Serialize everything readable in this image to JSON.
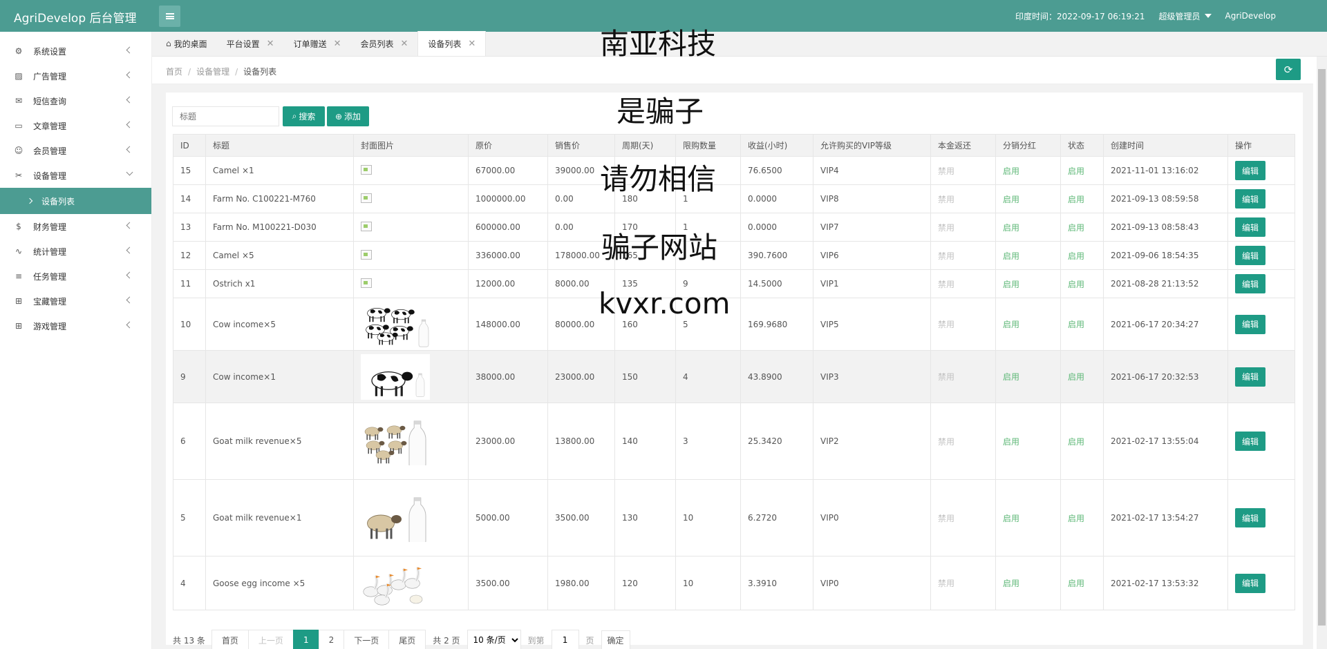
{
  "header": {
    "logo": "AgriDevelop 后台管理",
    "time_label": "印度时间：2022-09-17 06:19:21",
    "user_role": "超级管理员",
    "site_name": "AgriDevelop"
  },
  "sidebar": {
    "items": [
      {
        "label": "系统设置",
        "icon": "gear-icon"
      },
      {
        "label": "广告管理",
        "icon": "image-icon"
      },
      {
        "label": "短信查询",
        "icon": "mail-icon"
      },
      {
        "label": "文章管理",
        "icon": "book-icon"
      },
      {
        "label": "会员管理",
        "icon": "users-icon"
      },
      {
        "label": "设备管理",
        "icon": "tools-icon"
      },
      {
        "label": "设备列表",
        "icon": "chevron-right-icon"
      },
      {
        "label": "财务管理",
        "icon": "dollar-icon"
      },
      {
        "label": "统计管理",
        "icon": "pulse-icon"
      },
      {
        "label": "任务管理",
        "icon": "sliders-icon"
      },
      {
        "label": "宝藏管理",
        "icon": "gift-icon"
      },
      {
        "label": "游戏管理",
        "icon": "gift-icon"
      }
    ]
  },
  "tabs": [
    {
      "label": "我的桌面"
    },
    {
      "label": "平台设置"
    },
    {
      "label": "订单赠送"
    },
    {
      "label": "会员列表"
    },
    {
      "label": "设备列表"
    }
  ],
  "breadcrumb": [
    "首页",
    "设备管理",
    "设备列表"
  ],
  "toolbar": {
    "search_placeholder": "标题",
    "search_label": "搜索",
    "add_label": "添加"
  },
  "table": {
    "headers": [
      "ID",
      "标题",
      "封面图片",
      "原价",
      "销售价",
      "周期(天)",
      "限购数量",
      "收益(小时)",
      "允许购买的VIP等级",
      "本金返还",
      "分销分红",
      "状态",
      "创建时间",
      "操作"
    ],
    "rows": [
      {
        "id": "15",
        "title": "Camel ×1",
        "image": "broken",
        "price": "67000.00",
        "sale": "39000.00",
        "cycle": "",
        "limit": "",
        "income": "76.6500",
        "vip": "VIP4",
        "refund": "禁用",
        "share": "启用",
        "status": "启用",
        "created": "2021-11-01 13:16:02",
        "action": "编辑"
      },
      {
        "id": "14",
        "title": "Farm No. C100221-M760",
        "image": "broken",
        "price": "1000000.00",
        "sale": "0.00",
        "cycle": "180",
        "limit": "1",
        "income": "0.0000",
        "vip": "VIP8",
        "refund": "禁用",
        "share": "启用",
        "status": "启用",
        "created": "2021-09-13 08:59:58",
        "action": "编辑"
      },
      {
        "id": "13",
        "title": "Farm No. M100221-D030",
        "image": "broken",
        "price": "600000.00",
        "sale": "0.00",
        "cycle": "170",
        "limit": "1",
        "income": "0.0000",
        "vip": "VIP7",
        "refund": "禁用",
        "share": "启用",
        "status": "启用",
        "created": "2021-09-13 08:58:43",
        "action": "编辑"
      },
      {
        "id": "12",
        "title": "Camel ×5",
        "image": "broken",
        "price": "336000.00",
        "sale": "178000.00",
        "cycle": "165",
        "limit": "",
        "income": "390.7600",
        "vip": "VIP6",
        "refund": "禁用",
        "share": "启用",
        "status": "启用",
        "created": "2021-09-06 18:54:35",
        "action": "编辑"
      },
      {
        "id": "11",
        "title": "Ostrich x1",
        "image": "broken",
        "price": "12000.00",
        "sale": "8000.00",
        "cycle": "135",
        "limit": "9",
        "income": "14.5000",
        "vip": "VIP1",
        "refund": "禁用",
        "share": "启用",
        "status": "启用",
        "created": "2021-08-28 21:13:52",
        "action": "编辑"
      },
      {
        "id": "10",
        "title": "Cow income×5",
        "image": "cows5",
        "price": "148000.00",
        "sale": "80000.00",
        "cycle": "160",
        "limit": "5",
        "income": "169.9680",
        "vip": "VIP5",
        "refund": "禁用",
        "share": "启用",
        "status": "启用",
        "created": "2021-06-17 20:34:27",
        "action": "编辑"
      },
      {
        "id": "9",
        "title": "Cow income×1",
        "image": "cow1",
        "price": "38000.00",
        "sale": "23000.00",
        "cycle": "150",
        "limit": "4",
        "income": "43.8900",
        "vip": "VIP3",
        "refund": "禁用",
        "share": "启用",
        "status": "启用",
        "created": "2021-06-17 20:32:53",
        "action": "编辑"
      },
      {
        "id": "6",
        "title": "Goat milk revenue×5",
        "image": "goats5",
        "price": "23000.00",
        "sale": "13800.00",
        "cycle": "140",
        "limit": "3",
        "income": "25.3420",
        "vip": "VIP2",
        "refund": "禁用",
        "share": "启用",
        "status": "启用",
        "created": "2021-02-17 13:55:04",
        "action": "编辑"
      },
      {
        "id": "5",
        "title": "Goat milk revenue×1",
        "image": "goat1",
        "price": "5000.00",
        "sale": "3500.00",
        "cycle": "130",
        "limit": "10",
        "income": "6.2720",
        "vip": "VIP0",
        "refund": "禁用",
        "share": "启用",
        "status": "启用",
        "created": "2021-02-17 13:54:27",
        "action": "编辑"
      },
      {
        "id": "4",
        "title": "Goose egg income ×5",
        "image": "geese",
        "price": "3500.00",
        "sale": "1980.00",
        "cycle": "120",
        "limit": "10",
        "income": "3.3910",
        "vip": "VIP0",
        "refund": "禁用",
        "share": "启用",
        "status": "启用",
        "created": "2021-02-17 13:53:32",
        "action": "编辑"
      }
    ]
  },
  "pagination": {
    "total": "共 13 条",
    "first": "首页",
    "prev": "上一页",
    "pages": [
      "1",
      "2"
    ],
    "next": "下一页",
    "last": "尾页",
    "page_count": "共 2 页",
    "per_page": "10 条/页",
    "goto_label": "到第",
    "goto_value": "1",
    "page_unit": "页",
    "confirm": "确定"
  },
  "overlay": [
    "南亚科技",
    "是骗子",
    "请勿相信",
    "骗子网站",
    "kvxr.com"
  ],
  "colors": {
    "header": "#4c9c92",
    "primary": "#1e9b85",
    "enabled": "#5fb878",
    "disabled": "#c2c2c2"
  }
}
